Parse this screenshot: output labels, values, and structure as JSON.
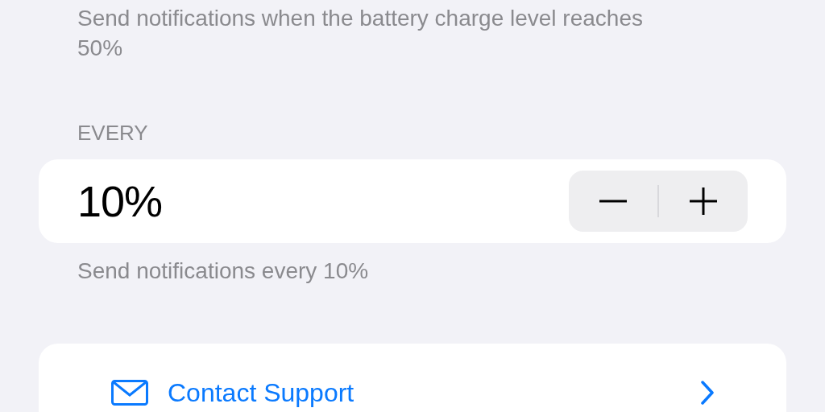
{
  "threshold_section": {
    "footer": "Send notifications when the battery charge level reaches 50%"
  },
  "every_section": {
    "header": "EVERY",
    "value": "10%",
    "footer": "Send notifications every 10%"
  },
  "actions": [
    {
      "label": "Contact Support"
    }
  ]
}
